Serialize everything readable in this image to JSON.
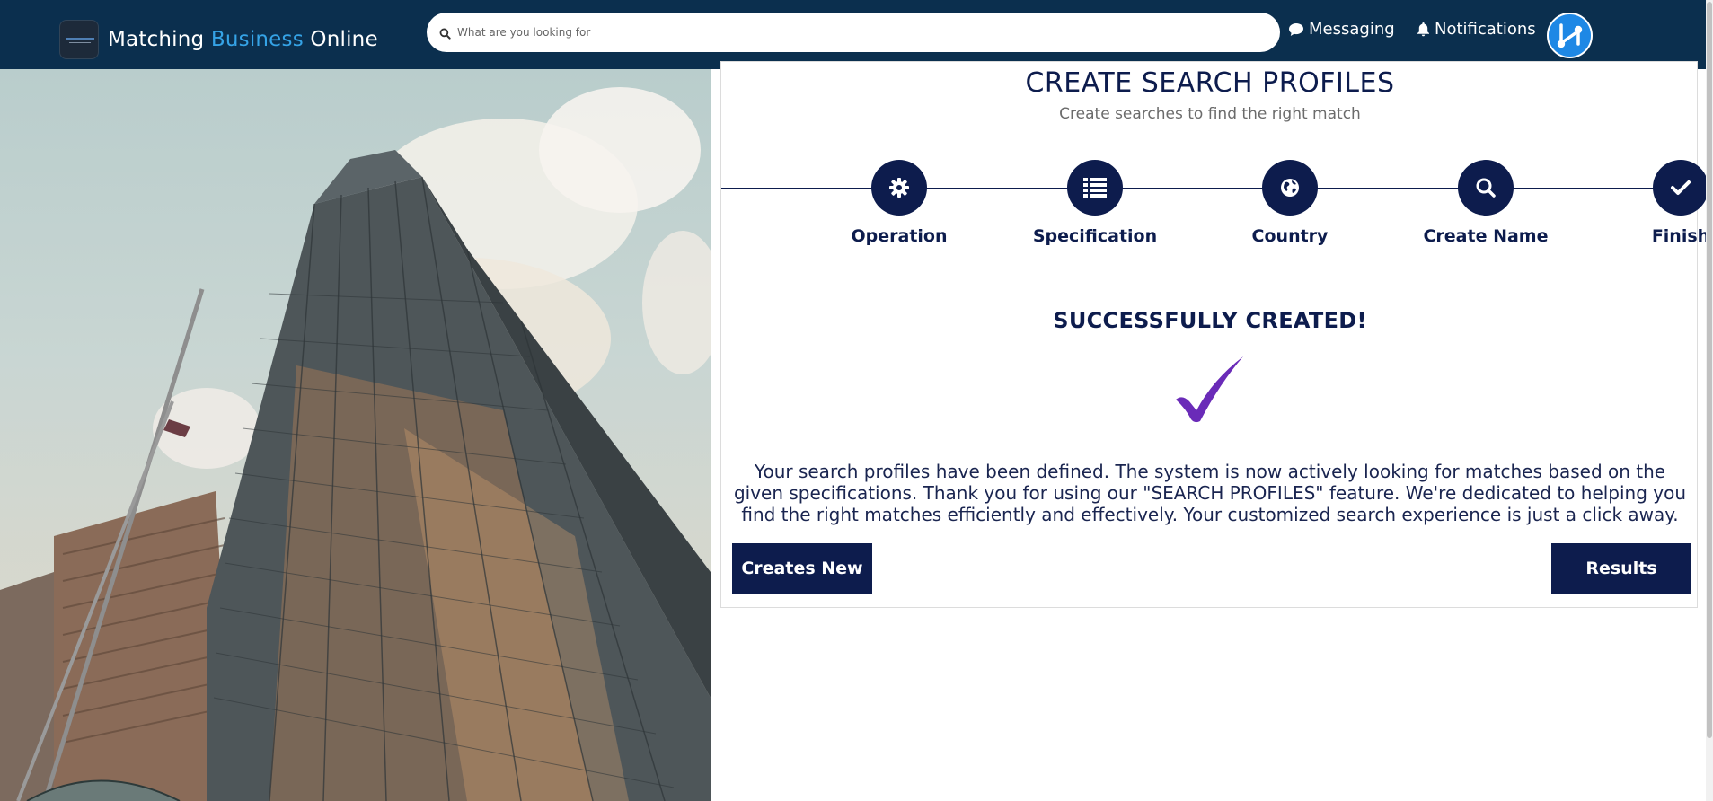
{
  "header": {
    "brand": {
      "part1": "Matching",
      "part2": "Business",
      "part3": "Online",
      "accent_color": "#35a3e6"
    },
    "search": {
      "placeholder": "What are you looking for",
      "value": ""
    },
    "nav": {
      "messaging": "Messaging",
      "notifications": "Notifications"
    },
    "background_color": "#0b2f4e"
  },
  "main": {
    "title": "CREATE SEARCH PROFILES",
    "subtitle": "Create searches to find the right match",
    "steps": [
      {
        "label": "Operation",
        "icon": "gear-icon"
      },
      {
        "label": "Specification",
        "icon": "list-icon"
      },
      {
        "label": "Country",
        "icon": "globe-icon"
      },
      {
        "label": "Create Name",
        "icon": "search-icon"
      },
      {
        "label": "Finish",
        "icon": "check-icon"
      }
    ],
    "success": {
      "title": "SUCCESSFULLY CREATED!",
      "message": "Your search profiles have been defined. The system is now actively looking for matches based on the given specifications. Thank you for using our \"SEARCH PROFILES\" feature. We're dedicated to helping you find the right matches efficiently and effectively. Your customized search experience is just a click away.",
      "check_color": "#6a2bb8"
    },
    "buttons": {
      "creates_new": "Creates New",
      "results": "Results"
    },
    "primary_color": "#0d1c4d"
  }
}
